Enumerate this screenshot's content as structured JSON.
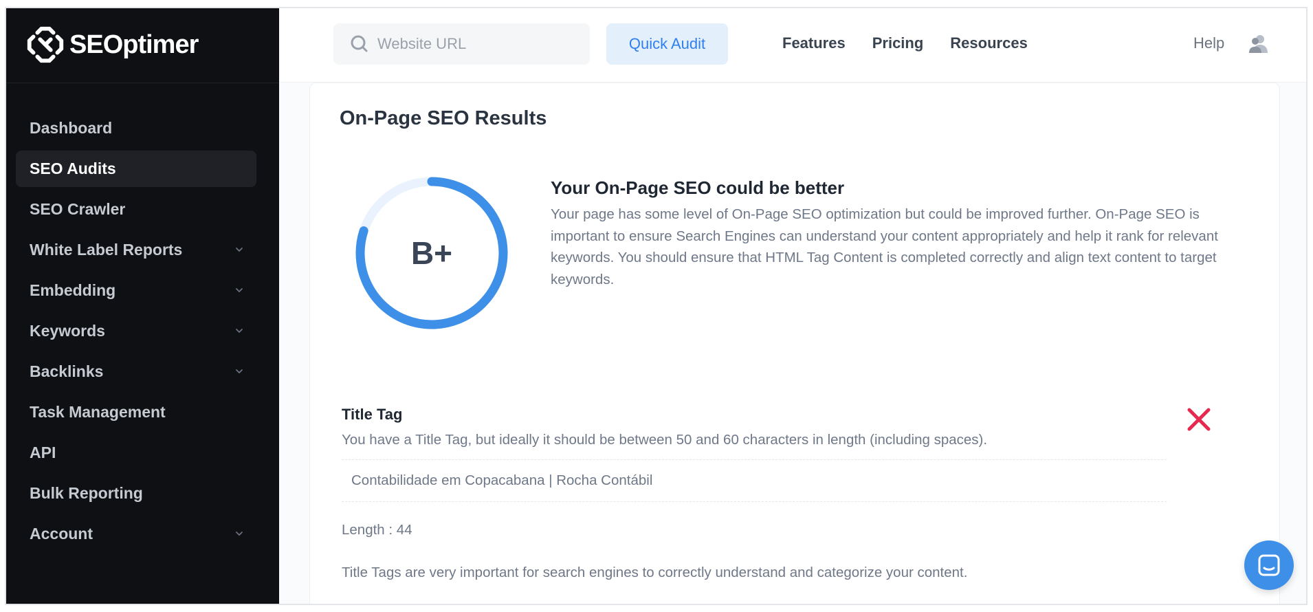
{
  "brand": {
    "name": "SEOptimer"
  },
  "sidebar": {
    "items": [
      {
        "label": "Dashboard",
        "active": false,
        "has_chevron": false
      },
      {
        "label": "SEO Audits",
        "active": true,
        "has_chevron": false
      },
      {
        "label": "SEO Crawler",
        "active": false,
        "has_chevron": false
      },
      {
        "label": "White Label Reports",
        "active": false,
        "has_chevron": true
      },
      {
        "label": "Embedding",
        "active": false,
        "has_chevron": true
      },
      {
        "label": "Keywords",
        "active": false,
        "has_chevron": true
      },
      {
        "label": "Backlinks",
        "active": false,
        "has_chevron": true
      },
      {
        "label": "Task Management",
        "active": false,
        "has_chevron": false
      },
      {
        "label": "API",
        "active": false,
        "has_chevron": false
      },
      {
        "label": "Bulk Reporting",
        "active": false,
        "has_chevron": false
      },
      {
        "label": "Account",
        "active": false,
        "has_chevron": true
      }
    ]
  },
  "topbar": {
    "search_placeholder": "Website URL",
    "quick_audit_label": "Quick Audit",
    "nav": [
      "Features",
      "Pricing",
      "Resources"
    ],
    "help_label": "Help"
  },
  "main": {
    "title": "On-Page SEO Results",
    "grade": "B+",
    "grade_fraction": 0.8,
    "score_heading": "Your On-Page SEO could be better",
    "score_description": "Your page has some level of On-Page SEO optimization but could be improved further. On-Page SEO is important to ensure Search Engines can understand your content appropriately and help it rank for relevant keywords. You should ensure that HTML Tag Content is completed correctly and align text content to target keywords.",
    "check": {
      "title": "Title Tag",
      "description": "You have a Title Tag, but ideally it should be between 50 and 60 characters in length (including spaces).",
      "value": "Contabilidade em Copacabana | Rocha Contábil",
      "length_text": "Length : 44",
      "note": "Title Tags are very important for search engines to correctly understand and categorize your content."
    }
  },
  "colors": {
    "sidebar_bg": "#0e1013",
    "accent": "#3d8fe8",
    "ring_track": "#eaf3fd",
    "fail": "#e8294f"
  },
  "icons": [
    "logo-gear-icon",
    "search-icon",
    "user-icon",
    "chevron-down-icon",
    "fail-x-icon",
    "chat-icon"
  ]
}
